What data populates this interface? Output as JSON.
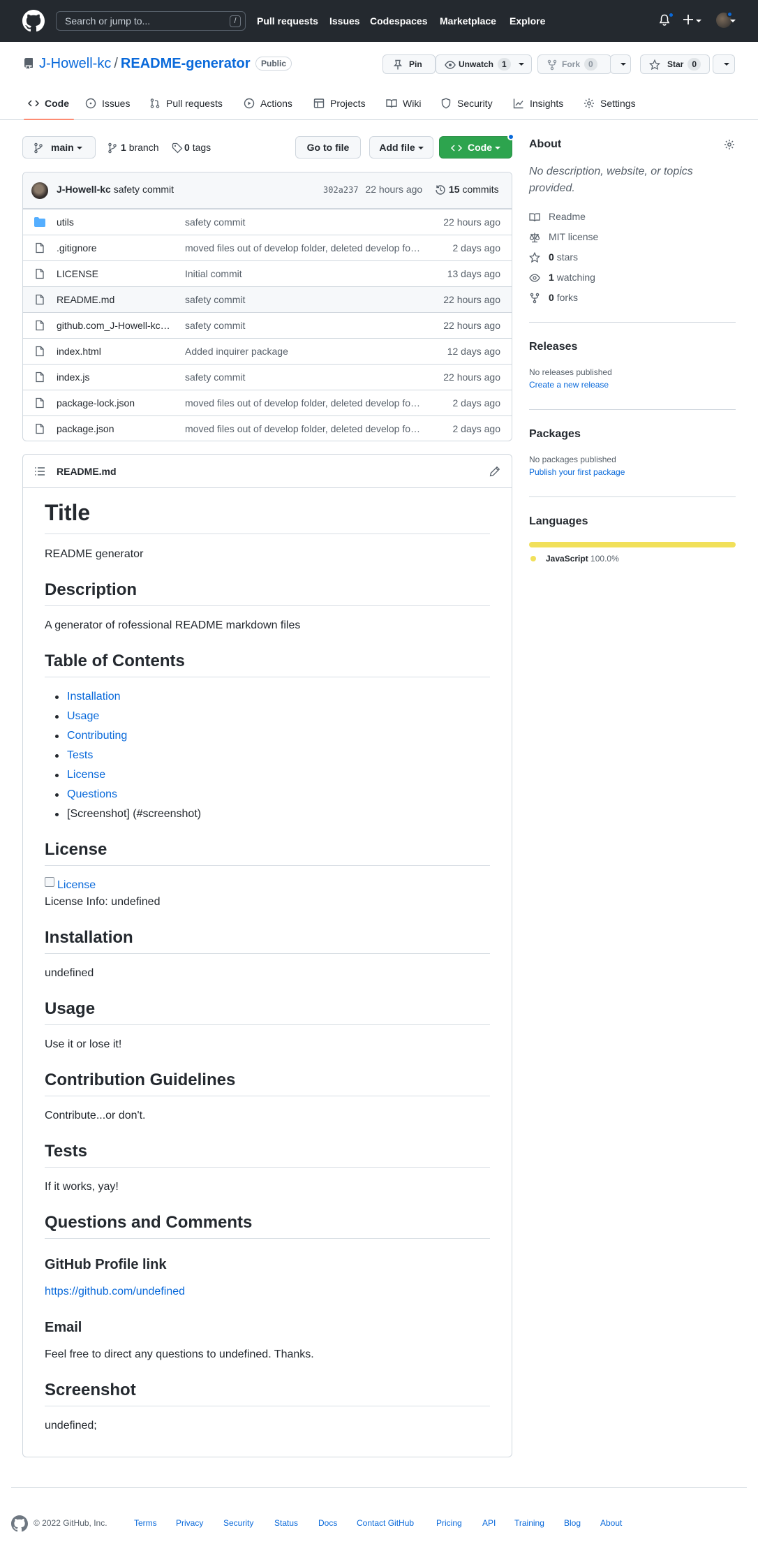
{
  "header": {
    "search_placeholder": "Search or jump to...",
    "search_shortcut": "/",
    "nav": [
      "Pull requests",
      "Issues",
      "Codespaces",
      "Marketplace",
      "Explore"
    ]
  },
  "repo": {
    "owner": "J-Howell-kc",
    "separator": "/",
    "name": "README-generator",
    "visibility": "Public",
    "pin_label": "Pin",
    "watch_label": "Unwatch",
    "watch_count": "1",
    "fork_label": "Fork",
    "fork_count": "0",
    "star_label": "Star",
    "star_count": "0"
  },
  "tabs": [
    "Code",
    "Issues",
    "Pull requests",
    "Actions",
    "Projects",
    "Wiki",
    "Security",
    "Insights",
    "Settings"
  ],
  "toolbar": {
    "branch": "main",
    "branches_count": "1",
    "branches_label": "branch",
    "tags_count": "0",
    "tags_label": "tags",
    "go_to_file": "Go to file",
    "add_file": "Add file",
    "code": "Code"
  },
  "latest_commit": {
    "author": "J-Howell-kc",
    "message": "safety commit",
    "sha": "302a237",
    "age": "22 hours ago",
    "commits_count": "15",
    "commits_label": "commits"
  },
  "files": [
    {
      "name": "utils",
      "type": "dir",
      "message": "safety commit",
      "age": "22 hours ago"
    },
    {
      "name": ".gitignore",
      "type": "file",
      "message": "moved files out of develop folder, deleted develop folder",
      "age": "2 days ago"
    },
    {
      "name": "LICENSE",
      "type": "file",
      "message": "Initial commit",
      "age": "13 days ago"
    },
    {
      "name": "README.md",
      "type": "file",
      "message": "safety commit",
      "age": "22 hours ago"
    },
    {
      "name": "github.com_J-Howell-kc_README-generator",
      "type": "file",
      "message": "safety commit",
      "age": "22 hours ago"
    },
    {
      "name": "index.html",
      "type": "file",
      "message": "Added inquirer package",
      "age": "12 days ago"
    },
    {
      "name": "index.js",
      "type": "file",
      "message": "safety commit",
      "age": "22 hours ago"
    },
    {
      "name": "package-lock.json",
      "type": "file",
      "message": "moved files out of develop folder, deleted develop folder",
      "age": "2 days ago"
    },
    {
      "name": "package.json",
      "type": "file",
      "message": "moved files out of develop folder, deleted develop folder",
      "age": "2 days ago"
    }
  ],
  "readme": {
    "filename": "README.md",
    "title": "Title",
    "title_text": "README generator",
    "description_heading": "Description",
    "description_text": "A generator of rofessional README markdown files",
    "toc_heading": "Table of Contents",
    "toc_links": [
      "Installation",
      "Usage",
      "Contributing",
      "Tests",
      "License",
      "Questions"
    ],
    "toc_plain": "[Screenshot] (#screenshot)",
    "license_heading": "License",
    "license_badge_alt": "License",
    "license_info": "License Info: undefined",
    "installation_heading": "Installation",
    "installation_text": "undefined",
    "usage_heading": "Usage",
    "usage_text": "Use it or lose it!",
    "contribution_heading": "Contribution Guidelines",
    "contribution_text": "Contribute...or don't.",
    "tests_heading": "Tests",
    "tests_text": "If it works, yay!",
    "questions_heading": "Questions and Comments",
    "profile_heading": "GitHub Profile link",
    "profile_link": "https://github.com/undefined",
    "email_heading": "Email",
    "email_text": "Feel free to direct any questions to undefined. Thanks.",
    "screenshot_heading": "Screenshot",
    "screenshot_text": "undefined;"
  },
  "sidebar": {
    "about_heading": "About",
    "about_desc": "No description, website, or topics provided.",
    "readme_label": "Readme",
    "license_label": "MIT license",
    "stars_count": "0",
    "stars_label": "stars",
    "watching_count": "1",
    "watching_label": "watching",
    "forks_count": "0",
    "forks_label": "forks",
    "releases_heading": "Releases",
    "releases_text": "No releases published",
    "releases_link": "Create a new release",
    "packages_heading": "Packages",
    "packages_text": "No packages published",
    "packages_link": "Publish your first package",
    "languages_heading": "Languages",
    "language_name": "JavaScript",
    "language_pct": "100.0%",
    "language_color": "#f1e05a"
  },
  "footer": {
    "copyright": "© 2022 GitHub, Inc.",
    "links": [
      "Terms",
      "Privacy",
      "Security",
      "Status",
      "Docs",
      "Contact GitHub",
      "Pricing",
      "API",
      "Training",
      "Blog",
      "About"
    ]
  },
  "colors": {
    "header_bg": "#24292f",
    "link": "#0969da",
    "code_button": "#2da44e",
    "active_tab_underline": "#fd8c73"
  }
}
